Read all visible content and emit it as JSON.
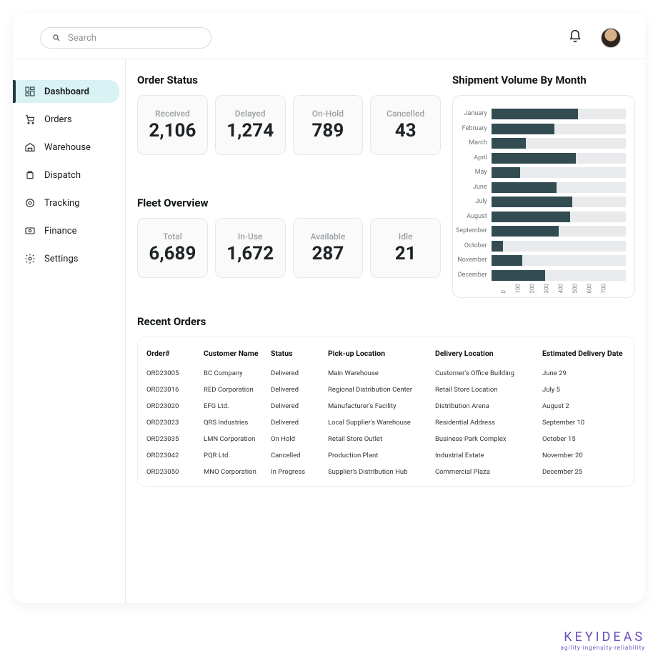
{
  "search": {
    "placeholder": "Search"
  },
  "sidebar": {
    "items": [
      {
        "label": "Dashboard"
      },
      {
        "label": "Orders"
      },
      {
        "label": "Warehouse"
      },
      {
        "label": "Dispatch"
      },
      {
        "label": "Tracking"
      },
      {
        "label": "Finance"
      },
      {
        "label": "Settings"
      }
    ]
  },
  "order_status": {
    "title": "Order Status",
    "cards": [
      {
        "label": "Received",
        "value": "2,106"
      },
      {
        "label": "Delayed",
        "value": "1,274"
      },
      {
        "label": "On-Hold",
        "value": "789"
      },
      {
        "label": "Cancelled",
        "value": "43"
      }
    ]
  },
  "fleet": {
    "title": "Fleet Overview",
    "cards": [
      {
        "label": "Total",
        "value": "6,689"
      },
      {
        "label": "In-Use",
        "value": "1,672"
      },
      {
        "label": "Available",
        "value": "287"
      },
      {
        "label": "Idle",
        "value": "21"
      }
    ]
  },
  "chart": {
    "title": "Shipment Volume By Month"
  },
  "chart_data": {
    "type": "bar",
    "orientation": "horizontal",
    "title": "Shipment Volume By Month",
    "xlabel": "",
    "ylabel": "",
    "xlim": [
      0,
      700
    ],
    "xticks": [
      0,
      100,
      200,
      300,
      400,
      500,
      600,
      700
    ],
    "categories": [
      "January",
      "February",
      "March",
      "April",
      "May",
      "June",
      "July",
      "August",
      "September",
      "October",
      "November",
      "December"
    ],
    "values": [
      450,
      330,
      180,
      440,
      150,
      340,
      420,
      410,
      350,
      60,
      160,
      280
    ]
  },
  "recent": {
    "title": "Recent Orders",
    "columns": [
      "Order#",
      "Customer Name",
      "Status",
      "Pick-up Location",
      "Delivery Location",
      "Estimated Delivery Date"
    ],
    "rows": [
      [
        "ORD23005",
        "BC Company",
        "Delivered",
        "Main Warehouse",
        "Customer's Office Building",
        "June 29"
      ],
      [
        "ORD23016",
        "RED Corporation",
        "Delivered",
        "Regional Distribution Center",
        "Retail Store Location",
        "July 5"
      ],
      [
        "ORD23020",
        "EFG Ltd.",
        "Delivered",
        "Manufacturer's Facility",
        "Distribution Arena",
        "August 2"
      ],
      [
        "ORD23023",
        "QRS Industries",
        "Delivered",
        "Local Supplier's Warehouse",
        "Residential Address",
        "September 10"
      ],
      [
        "ORD23035",
        "LMN Corporation",
        "On Hold",
        "Retail Store Outlet",
        "Business Park Complex",
        "October 15"
      ],
      [
        "ORD23042",
        "PQR Ltd.",
        "Cancelled",
        "Production Plant",
        "Industrial Estate",
        "November 20"
      ],
      [
        "ORD23050",
        "MNO Corporation",
        "In Progress",
        "Supplier's Distribution Hub",
        "Commercial Plaza",
        "December 25"
      ]
    ]
  },
  "footer": {
    "brand": "KEYIDEAS",
    "tag": "agility·ingenuity·reliability"
  }
}
